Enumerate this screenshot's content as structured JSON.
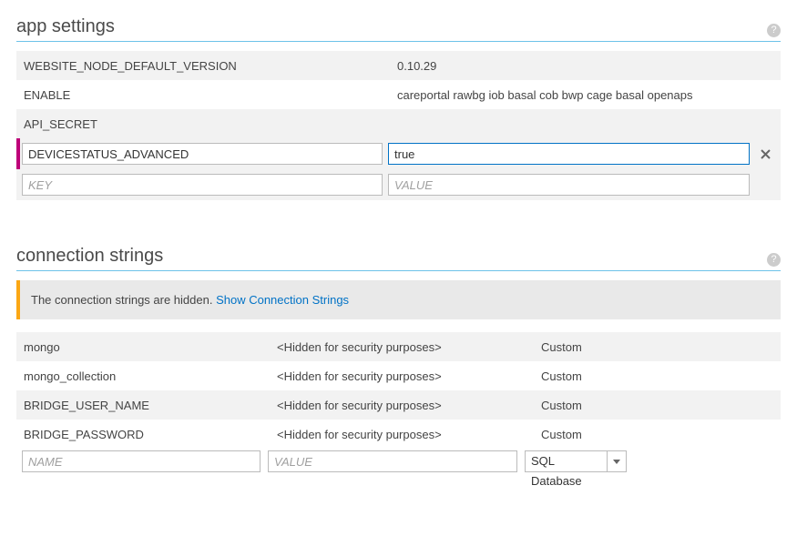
{
  "appSettings": {
    "title": "app settings",
    "rows": [
      {
        "key": "WEBSITE_NODE_DEFAULT_VERSION",
        "value": "0.10.29"
      },
      {
        "key": "ENABLE",
        "value": "careportal rawbg iob basal cob bwp cage basal openaps"
      },
      {
        "key": "API_SECRET",
        "value": ""
      }
    ],
    "edit": {
      "key": "DEVICESTATUS_ADVANCED",
      "value": "true"
    },
    "placeholders": {
      "key": "KEY",
      "value": "VALUE"
    }
  },
  "connectionStrings": {
    "title": "connection strings",
    "notice_text": "The connection strings are hidden. ",
    "notice_link": "Show Connection Strings",
    "hidden_value": "<Hidden for security purposes>",
    "rows": [
      {
        "name": "mongo",
        "type": "Custom"
      },
      {
        "name": "mongo_collection",
        "type": "Custom"
      },
      {
        "name": "BRIDGE_USER_NAME",
        "type": "Custom"
      },
      {
        "name": "BRIDGE_PASSWORD",
        "type": "Custom"
      }
    ],
    "placeholders": {
      "name": "NAME",
      "value": "VALUE"
    },
    "selectDefault": "SQL Database"
  }
}
